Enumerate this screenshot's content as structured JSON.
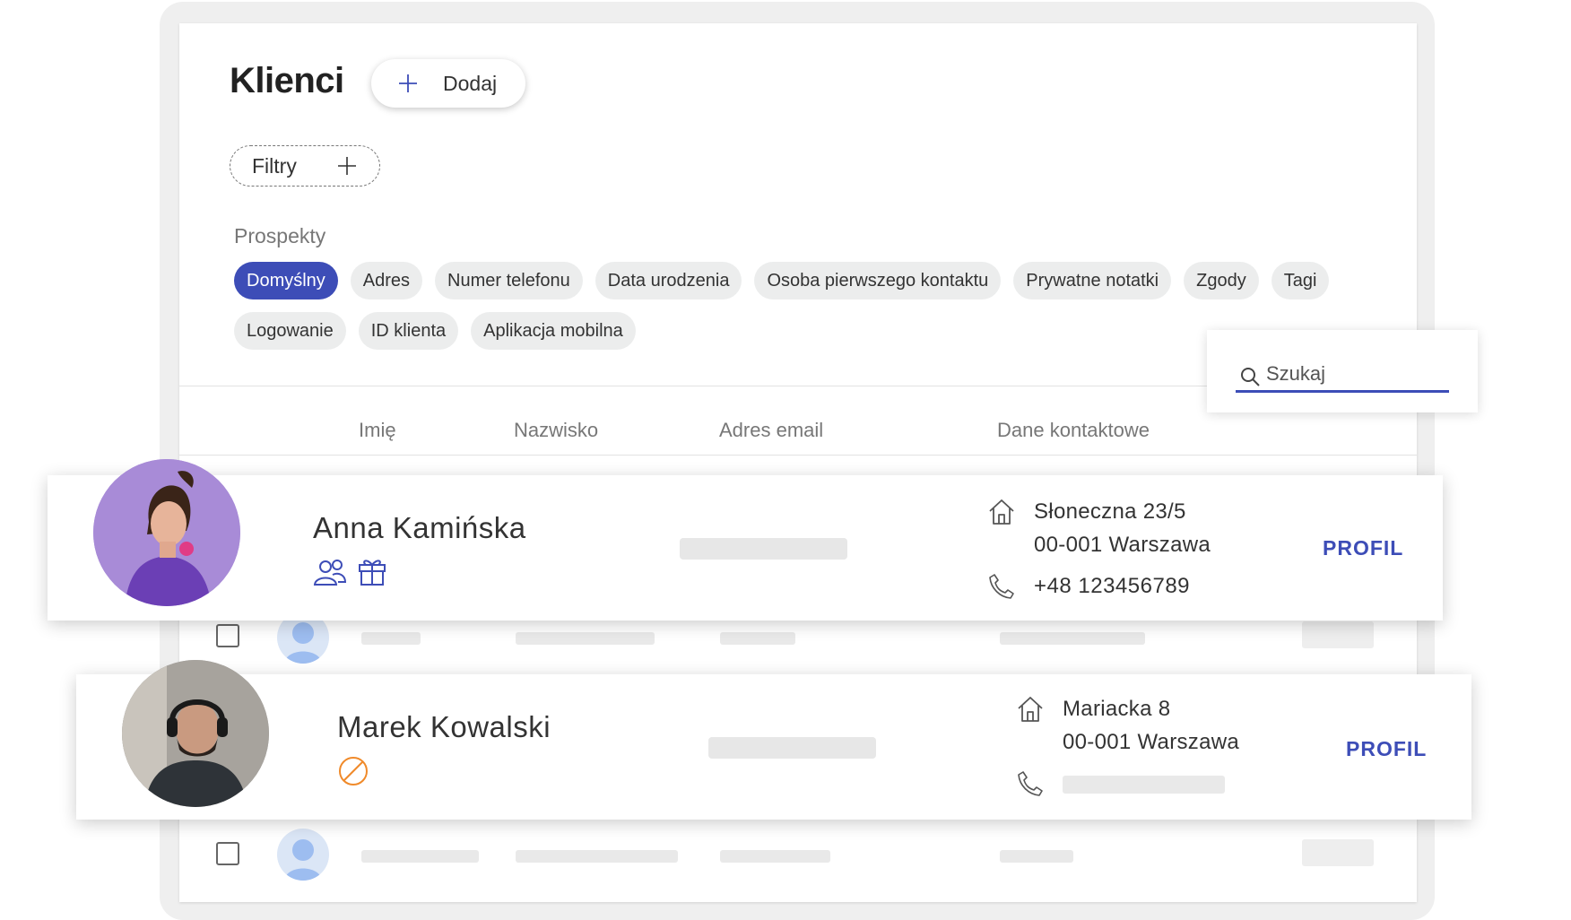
{
  "header": {
    "title": "Klienci",
    "add_label": "Dodaj",
    "filters_label": "Filtry"
  },
  "section": {
    "label": "Prospekty"
  },
  "chips_row1": [
    "Domyślny",
    "Adres",
    "Numer telefonu",
    "Data urodzenia",
    "Osoba pierwszego kontaktu",
    "Prywatne notatki",
    "Zgody",
    "Tagi"
  ],
  "chips_row2": [
    "Logowanie",
    "ID klienta",
    "Aplikacja mobilna"
  ],
  "active_chip": "Domyślny",
  "search": {
    "placeholder": "Szukaj"
  },
  "table": {
    "columns": [
      "Imię",
      "Nazwisko",
      "Adres email",
      "Dane kontaktowe"
    ]
  },
  "clients": [
    {
      "name": "Anna Kamińska",
      "address_line1": "Słoneczna 23/5",
      "address_line2": "00-001 Warszawa",
      "phone": "+48 123456789",
      "profile_label": "PROFIL",
      "icons": [
        "group-icon",
        "gift-icon"
      ]
    },
    {
      "name": "Marek Kowalski",
      "address_line1": "Mariacka 8",
      "address_line2": "00-001 Warszawa",
      "phone": "",
      "profile_label": "PROFIL",
      "icons": [
        "blocked-icon"
      ]
    }
  ],
  "colors": {
    "accent": "#3d4db7",
    "warning": "#f08a2a",
    "chip_bg": "#eceded"
  }
}
